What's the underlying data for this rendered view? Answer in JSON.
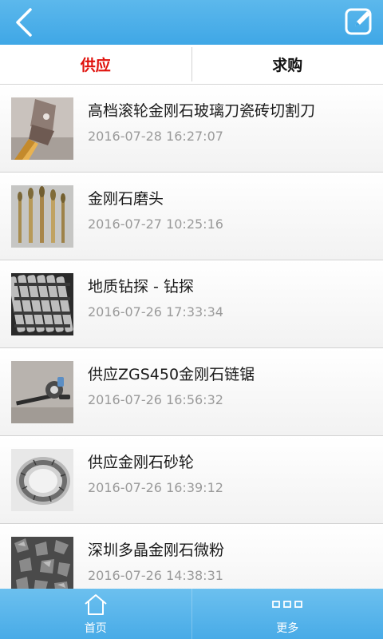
{
  "colors": {
    "top_bar": "#4aaeea",
    "active_tab": "#e0120c",
    "bottom_bar": "#5ab6eb",
    "date_text": "#9a9a9a"
  },
  "header": {
    "back_icon": "chevron-left-icon",
    "edit_icon": "edit-icon"
  },
  "tabs": [
    {
      "label": "供应",
      "active": true
    },
    {
      "label": "求购",
      "active": false
    }
  ],
  "items": [
    {
      "title": "高档滚轮金刚石玻璃刀瓷砖切割刀",
      "date": "2016-07-28 16:27:07",
      "thumb": "glass-cutter"
    },
    {
      "title": "金刚石磨头",
      "date": "2016-07-27 10:25:16",
      "thumb": "grinding-heads"
    },
    {
      "title": "地质钻探 - 钻探",
      "date": "2016-07-26 17:33:34",
      "thumb": "drill-rods"
    },
    {
      "title": "供应ZGS450金刚石链锯",
      "date": "2016-07-26 16:56:32",
      "thumb": "chain-saw"
    },
    {
      "title": "供应金刚石砂轮",
      "date": "2016-07-26 16:39:12",
      "thumb": "grinding-wheel"
    },
    {
      "title": "深圳多晶金刚石微粉",
      "date": "2016-07-26 14:38:31",
      "thumb": "diamond-powder"
    }
  ],
  "bottom_nav": [
    {
      "label": "首页",
      "icon": "home-icon"
    },
    {
      "label": "更多",
      "icon": "more-icon"
    }
  ]
}
